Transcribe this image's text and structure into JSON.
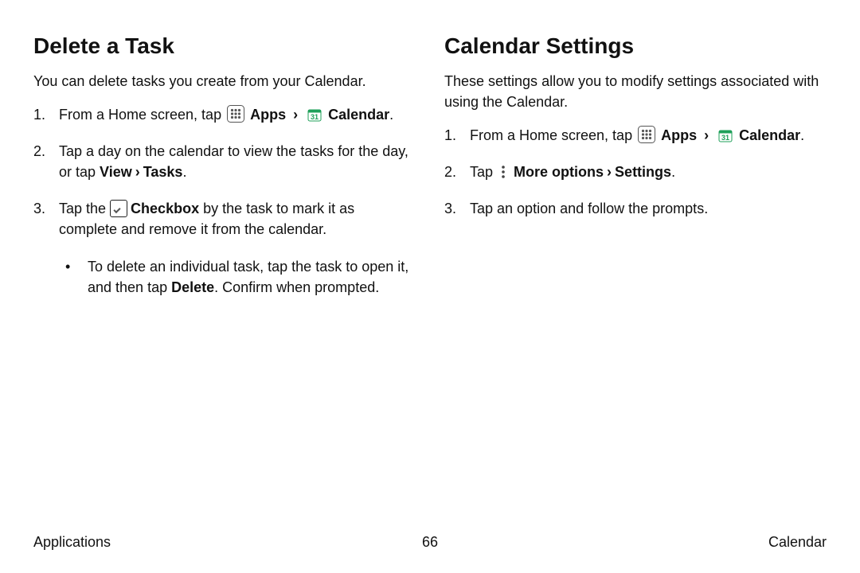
{
  "left": {
    "heading": "Delete a Task",
    "intro": "You can delete tasks you create from your Calendar.",
    "step1_pre": "From a Home screen, tap ",
    "apps": "Apps",
    "calendar": "Calendar",
    "step2_a": "Tap a day on the calendar to view the tasks for the day, or tap ",
    "step2_b": "View",
    "step2_c": "Tasks",
    "step3_a": "Tap the ",
    "step3_b": "Checkbox",
    "step3_c": " by the task to mark it as complete and remove it from the calendar.",
    "sub_a": "To delete an individual task, tap the task to open it, and then tap ",
    "sub_b": "Delete",
    "sub_c": ". Confirm when prompted."
  },
  "right": {
    "heading": "Calendar Settings",
    "intro": "These settings allow you to modify settings associated with using the Calendar.",
    "step1_pre": "From a Home screen, tap ",
    "apps": "Apps",
    "calendar": "Calendar",
    "step2_a": "Tap ",
    "step2_b": "More options",
    "step2_c": "Settings",
    "step3": "Tap an option and follow the prompts."
  },
  "nums": {
    "n1": "1.",
    "n2": "2.",
    "n3": "3."
  },
  "chev": "›",
  "period": ".",
  "footer": {
    "left": "Applications",
    "page": "66",
    "right": "Calendar"
  }
}
